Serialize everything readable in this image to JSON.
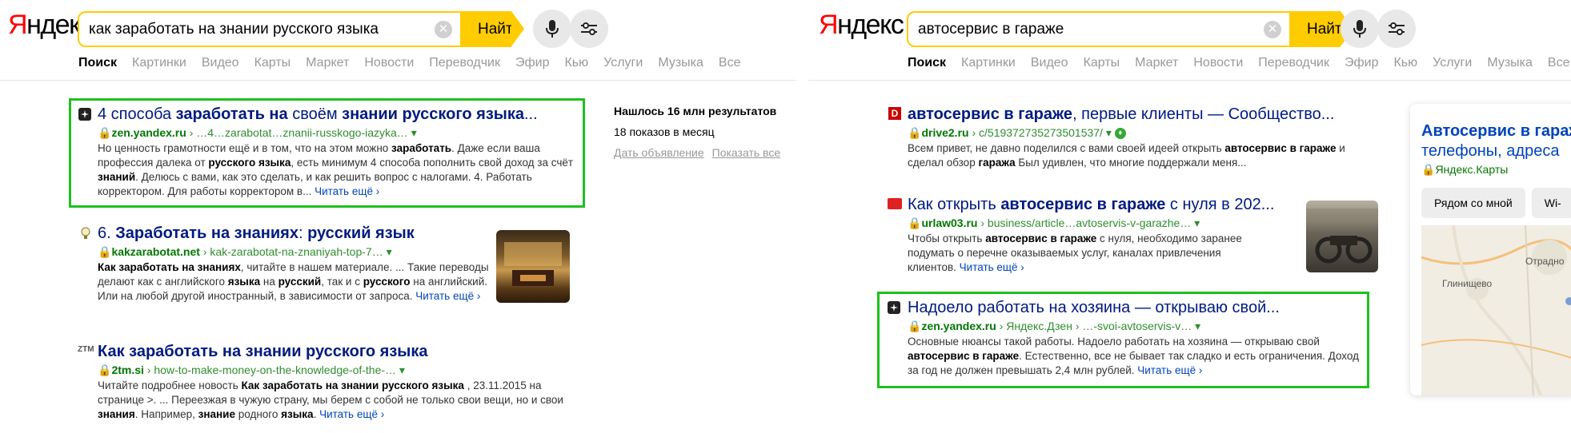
{
  "left": {
    "logo": "Яндекс",
    "query": "как заработать на знании русского языка",
    "find_label": "Найти",
    "tabs": [
      "Поиск",
      "Картинки",
      "Видео",
      "Карты",
      "Маркет",
      "Новости",
      "Переводчик",
      "Эфир",
      "Кью",
      "Услуги",
      "Музыка",
      "Все"
    ],
    "stats": {
      "found": "Нашлось 16 млн результатов",
      "impressions": "18 показов в месяц",
      "ad_link": "Дать объявление",
      "show_all": "Показать все"
    },
    "results": [
      {
        "title_a": "4 способа ",
        "title_b": "заработать на",
        "title_c": " своём ",
        "title_d": "знании русского языка",
        "title_e": "...",
        "domain": "zen.yandex.ru",
        "path": " › …4…zarabotat…znanii-russkogo-iazyka… ▾",
        "snip_1": "Но ценность грамотности ещё и в том, что на этом можно ",
        "snip_1b": "заработать",
        "snip_2": ". Даже если ваша профессия далека от ",
        "snip_2b": "русского языка",
        "snip_3": ", есть минимум 4 способа пополнить свой доход за счёт ",
        "snip_3b": "знаний",
        "snip_4": ". Делюсь с вами, как это сделать, и как решить вопрос с налогами. 4. Работать корректором. Для работы корректором в... ",
        "more": "Читать ещё ›"
      },
      {
        "title_a": "6. ",
        "title_b": "Заработать на знаниях",
        "title_c": ": ",
        "title_d": "русский язык",
        "domain": "kakzarabotat.net",
        "path": " › kak-zarabotat-na-znaniyah-top-7… ▾",
        "snip_1b": "Как заработать на знаниях",
        "snip_1": ", читайте в нашем материале. ... Такие переводы делают как с английского ",
        "snip_2b": "языка",
        "snip_2": " на ",
        "snip_3b": "русский",
        "snip_3": ", так и с ",
        "snip_4b": "русского",
        "snip_4": " на английский. Или на любой другой иностранный, в зависимости от запроса. ",
        "more": "Читать ещё ›"
      },
      {
        "favicon_text": "ZTM",
        "title": "Как заработать на знании русского языка",
        "domain": "2tm.si",
        "path": " › how-to-make-money-on-the-knowledge-of-the-… ▾",
        "snip_1": "Читайте подробнее новость ",
        "snip_1b": "Как заработать на знании русского языка",
        "snip_2": " , 23.11.2015 на странице >. ... Переезжая в чужую страну, мы берем с собой не только свои вещи, но и свои ",
        "snip_2b": "знания",
        "snip_3": ". Например, ",
        "snip_3b": "знание",
        "snip_4": " родного ",
        "snip_4b": "языка",
        "snip_5": ". ",
        "more": "Читать ещё ›"
      }
    ]
  },
  "right": {
    "logo": "Яндекс",
    "query": "автосервис в гараже",
    "find_label": "Найти",
    "tabs": [
      "Поиск",
      "Картинки",
      "Видео",
      "Карты",
      "Маркет",
      "Новости",
      "Переводчик",
      "Эфир",
      "Кью",
      "Услуги",
      "Музыка",
      "Все"
    ],
    "results": [
      {
        "favicon_text": "D",
        "title_b": "автосервис в гараже",
        "title_c": ", первые клиенты — Сообщество...",
        "domain": "drive2.ru",
        "path": " › c/519372735273501537/ ▾",
        "snip_1": "Всем привет, не давно поделился с вами своей идеей открыть ",
        "snip_1b": "автосервис в гараже",
        "snip_2": " и сделал обзор ",
        "snip_2b": "гаража",
        "snip_3": " Был удивлен, что многие поддержали меня..."
      },
      {
        "title_a": "Как открыть ",
        "title_b": "автосервис в гараже",
        "title_c": " с нуля в 202...",
        "domain": "urlaw03.ru",
        "path": " › business/article…avtoservis-v-garazhe… ▾",
        "snip_1": "Чтобы открыть ",
        "snip_1b": "автосервис в гараже",
        "snip_2": " с нуля, необходимо заранее подумать о перечне оказываемых услуг, каналах привлечения клиентов. ",
        "more": "Читать ещё ›"
      },
      {
        "title": "Надоело работать на хозяина — открываю свой...",
        "domain": "zen.yandex.ru",
        "path": " › Яндекс.Дзен › …-svoi-avtoservis-v… ▾",
        "snip_1": "Основные нюансы такой работы. Надоело работать на хозяина — открываю свой ",
        "snip_1b": "автосервис в гараже",
        "snip_2": ". Естественно, все не бывает так сладко и есть ограничения. Доход за год не должен превышать 2,4 млн рублей. ",
        "more": "Читать ещё ›"
      }
    ],
    "card": {
      "title": "Автосервис в гараже",
      "subtitle": "телефоны, адреса",
      "source": "Яндекс.Карты",
      "chip_1": "Рядом со мной",
      "chip_2": "Wi-",
      "map_labels": [
        "Отрадно",
        "Глинищево"
      ]
    }
  },
  "colors": {
    "accent": "#ffcc00",
    "link": "#001a80",
    "url_green": "#007700",
    "highlight_box": "#1fbf1f"
  }
}
